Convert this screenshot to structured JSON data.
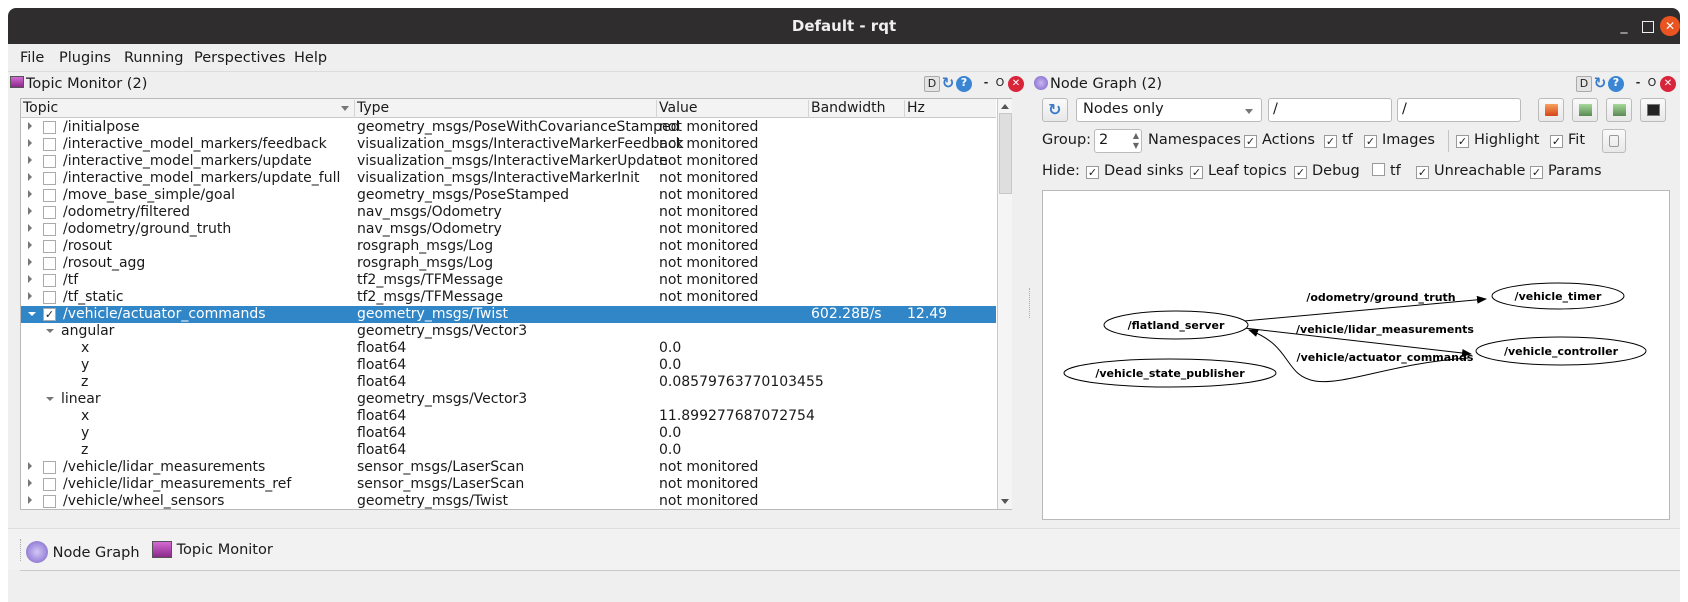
{
  "window": {
    "title": "Default - rqt",
    "controls": [
      "minimize",
      "maximize",
      "close"
    ]
  },
  "menubar": {
    "items": [
      "File",
      "Plugins",
      "Running",
      "Perspectives",
      "Help"
    ]
  },
  "topic_monitor": {
    "title": "Topic Monitor (2)",
    "dock_buttons": {
      "d": "D",
      "dash": "-",
      "o": "O"
    },
    "columns": [
      "Topic",
      "Type",
      "Value",
      "Bandwidth",
      "Hz"
    ],
    "rows": [
      {
        "topic": "/initialpose",
        "type": "geometry_msgs/PoseWithCovarianceStamped",
        "value": "not monitored",
        "bandwidth": "",
        "hz": "",
        "checked": false,
        "expanded": false,
        "level": 0
      },
      {
        "topic": "/interactive_model_markers/feedback",
        "type": "visualization_msgs/InteractiveMarkerFeedback",
        "value": "not monitored",
        "bandwidth": "",
        "hz": "",
        "checked": false,
        "expanded": false,
        "level": 0
      },
      {
        "topic": "/interactive_model_markers/update",
        "type": "visualization_msgs/InteractiveMarkerUpdate",
        "value": "not monitored",
        "bandwidth": "",
        "hz": "",
        "checked": false,
        "expanded": false,
        "level": 0
      },
      {
        "topic": "/interactive_model_markers/update_full",
        "type": "visualization_msgs/InteractiveMarkerInit",
        "value": "not monitored",
        "bandwidth": "",
        "hz": "",
        "checked": false,
        "expanded": false,
        "level": 0
      },
      {
        "topic": "/move_base_simple/goal",
        "type": "geometry_msgs/PoseStamped",
        "value": "not monitored",
        "bandwidth": "",
        "hz": "",
        "checked": false,
        "expanded": false,
        "level": 0
      },
      {
        "topic": "/odometry/filtered",
        "type": "nav_msgs/Odometry",
        "value": "not monitored",
        "bandwidth": "",
        "hz": "",
        "checked": false,
        "expanded": false,
        "level": 0
      },
      {
        "topic": "/odometry/ground_truth",
        "type": "nav_msgs/Odometry",
        "value": "not monitored",
        "bandwidth": "",
        "hz": "",
        "checked": false,
        "expanded": false,
        "level": 0
      },
      {
        "topic": "/rosout",
        "type": "rosgraph_msgs/Log",
        "value": "not monitored",
        "bandwidth": "",
        "hz": "",
        "checked": false,
        "expanded": false,
        "level": 0
      },
      {
        "topic": "/rosout_agg",
        "type": "rosgraph_msgs/Log",
        "value": "not monitored",
        "bandwidth": "",
        "hz": "",
        "checked": false,
        "expanded": false,
        "level": 0
      },
      {
        "topic": "/tf",
        "type": "tf2_msgs/TFMessage",
        "value": "not monitored",
        "bandwidth": "",
        "hz": "",
        "checked": false,
        "expanded": false,
        "level": 0
      },
      {
        "topic": "/tf_static",
        "type": "tf2_msgs/TFMessage",
        "value": "not monitored",
        "bandwidth": "",
        "hz": "",
        "checked": false,
        "expanded": false,
        "level": 0
      },
      {
        "topic": "/vehicle/actuator_commands",
        "type": "geometry_msgs/Twist",
        "value": "",
        "bandwidth": "602.28B/s",
        "hz": "12.49",
        "checked": true,
        "expanded": true,
        "level": 0,
        "selected": true
      },
      {
        "topic": "angular",
        "type": "geometry_msgs/Vector3",
        "value": "",
        "bandwidth": "",
        "hz": "",
        "expanded": true,
        "level": 1
      },
      {
        "topic": "x",
        "type": "float64",
        "value": "0.0",
        "bandwidth": "",
        "hz": "",
        "level": 2
      },
      {
        "topic": "y",
        "type": "float64",
        "value": "0.0",
        "bandwidth": "",
        "hz": "",
        "level": 2
      },
      {
        "topic": "z",
        "type": "float64",
        "value": "0.08579763770103455",
        "bandwidth": "",
        "hz": "",
        "level": 2
      },
      {
        "topic": "linear",
        "type": "geometry_msgs/Vector3",
        "value": "",
        "bandwidth": "",
        "hz": "",
        "expanded": true,
        "level": 1
      },
      {
        "topic": "x",
        "type": "float64",
        "value": "11.899277687072754",
        "bandwidth": "",
        "hz": "",
        "level": 2
      },
      {
        "topic": "y",
        "type": "float64",
        "value": "0.0",
        "bandwidth": "",
        "hz": "",
        "level": 2
      },
      {
        "topic": "z",
        "type": "float64",
        "value": "0.0",
        "bandwidth": "",
        "hz": "",
        "level": 2
      },
      {
        "topic": "/vehicle/lidar_measurements",
        "type": "sensor_msgs/LaserScan",
        "value": "not monitored",
        "bandwidth": "",
        "hz": "",
        "checked": false,
        "expanded": false,
        "level": 0
      },
      {
        "topic": "/vehicle/lidar_measurements_ref",
        "type": "sensor_msgs/LaserScan",
        "value": "not monitored",
        "bandwidth": "",
        "hz": "",
        "checked": false,
        "expanded": false,
        "level": 0
      },
      {
        "topic": "/vehicle/wheel_sensors",
        "type": "geometry_msgs/Twist",
        "value": "not monitored",
        "bandwidth": "",
        "hz": "",
        "checked": false,
        "expanded": false,
        "level": 0
      }
    ]
  },
  "node_graph": {
    "title": "Node Graph (2)",
    "dock_buttons": {
      "d": "D",
      "dash": "-",
      "o": "O"
    },
    "mode": "Nodes only",
    "filter_1": "/",
    "filter_2": "/",
    "group_label": "Group:",
    "group_value": "2",
    "options": [
      {
        "label": "Namespaces",
        "checked": null
      },
      {
        "label": "Actions",
        "checked": true
      },
      {
        "label": "tf",
        "checked": true
      },
      {
        "label": "Images",
        "checked": true
      },
      {
        "label": "Highlight",
        "checked": true
      },
      {
        "label": "Fit",
        "checked": true
      }
    ],
    "hide_label": "Hide:",
    "hide": [
      {
        "label": "Dead sinks",
        "checked": true
      },
      {
        "label": "Leaf topics",
        "checked": true
      },
      {
        "label": "Debug",
        "checked": true
      },
      {
        "label": "tf",
        "checked": false
      },
      {
        "label": "Unreachable",
        "checked": true
      },
      {
        "label": "Params",
        "checked": true
      }
    ],
    "graph": {
      "nodes": [
        "/flatland_server",
        "/vehicle_timer",
        "/vehicle_controller",
        "/vehicle_state_publisher"
      ],
      "edges": [
        {
          "from": "/flatland_server",
          "to": "/vehicle_timer",
          "label": "/odometry/ground_truth"
        },
        {
          "from": "/flatland_server",
          "to": "/vehicle_controller",
          "label": "/vehicle/lidar_measurements"
        },
        {
          "from": "/vehicle_controller",
          "to": "/flatland_server",
          "label": "/vehicle/actuator_commands"
        }
      ]
    }
  },
  "bottom_toolbar": {
    "items": [
      "Node Graph",
      "Topic Monitor"
    ]
  }
}
